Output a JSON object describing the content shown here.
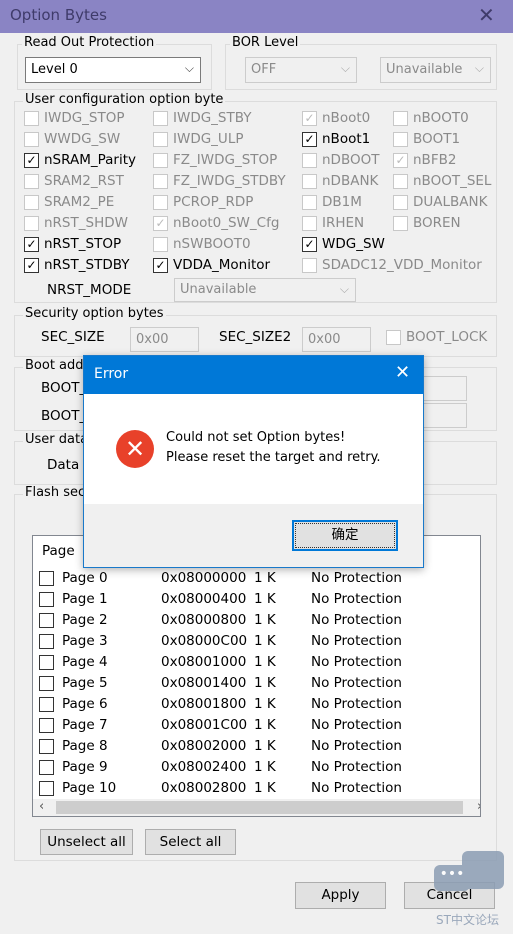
{
  "window": {
    "title": "Option Bytes",
    "close_icon": "close-icon"
  },
  "rop": {
    "label": "Read Out Protection",
    "value": "Level 0"
  },
  "bor": {
    "label": "BOR Level",
    "value": "OFF",
    "value2": "Unavailable"
  },
  "user_config": {
    "label": "User configuration option byte",
    "items": [
      [
        {
          "label": "IWDG_STOP",
          "checked": false,
          "enabled": false
        },
        {
          "label": "IWDG_STBY",
          "checked": false,
          "enabled": false
        },
        {
          "label": "nBoot0",
          "checked": true,
          "enabled": false
        },
        {
          "label": "nBOOT0",
          "checked": false,
          "enabled": false
        }
      ],
      [
        {
          "label": "WWDG_SW",
          "checked": false,
          "enabled": false
        },
        {
          "label": "IWDG_ULP",
          "checked": false,
          "enabled": false
        },
        {
          "label": "nBoot1",
          "checked": true,
          "enabled": true
        },
        {
          "label": "BOOT1",
          "checked": false,
          "enabled": false
        }
      ],
      [
        {
          "label": "nSRAM_Parity",
          "checked": true,
          "enabled": true
        },
        {
          "label": "FZ_IWDG_STOP",
          "checked": false,
          "enabled": false
        },
        {
          "label": "nDBOOT",
          "checked": false,
          "enabled": false
        },
        {
          "label": "nBFB2",
          "checked": true,
          "enabled": false
        }
      ],
      [
        {
          "label": "SRAM2_RST",
          "checked": false,
          "enabled": false
        },
        {
          "label": "FZ_IWDG_STDBY",
          "checked": false,
          "enabled": false
        },
        {
          "label": "nDBANK",
          "checked": false,
          "enabled": false
        },
        {
          "label": "nBOOT_SEL",
          "checked": false,
          "enabled": false
        }
      ],
      [
        {
          "label": "SRAM2_PE",
          "checked": false,
          "enabled": false
        },
        {
          "label": "PCROP_RDP",
          "checked": false,
          "enabled": false
        },
        {
          "label": "DB1M",
          "checked": false,
          "enabled": false
        },
        {
          "label": "DUALBANK",
          "checked": false,
          "enabled": false
        }
      ],
      [
        {
          "label": "nRST_SHDW",
          "checked": false,
          "enabled": false
        },
        {
          "label": "nBoot0_SW_Cfg",
          "checked": true,
          "enabled": false
        },
        {
          "label": "IRHEN",
          "checked": false,
          "enabled": false
        },
        {
          "label": "BOREN",
          "checked": false,
          "enabled": false
        }
      ],
      [
        {
          "label": "nRST_STOP",
          "checked": true,
          "enabled": true
        },
        {
          "label": "nSWBOOT0",
          "checked": false,
          "enabled": false
        },
        {
          "label": "WDG_SW",
          "checked": true,
          "enabled": true
        }
      ],
      [
        {
          "label": "nRST_STDBY",
          "checked": true,
          "enabled": true
        },
        {
          "label": "VDDA_Monitor",
          "checked": true,
          "enabled": true
        },
        {
          "label": "SDADC12_VDD_Monitor",
          "checked": false,
          "enabled": false
        }
      ]
    ],
    "nrst_mode_label": "NRST_MODE",
    "nrst_mode_value": "Unavailable"
  },
  "security": {
    "label": "Security option bytes",
    "sec_size_label": "SEC_SIZE",
    "sec_size": "0x00",
    "sec_size2_label": "SEC_SIZE2",
    "sec_size2": "0x00",
    "boot_lock": "BOOT_LOCK"
  },
  "boot_addr": {
    "label": "Boot addr",
    "boot0": "BOOT_",
    "boot1": "BOOT_"
  },
  "user_data": {
    "label": "User data",
    "data0": "Data 0"
  },
  "flash": {
    "label": "Flash sect",
    "header": "Page",
    "rows": [
      [
        "Page 0",
        "0x08000000",
        "1 K",
        "No Protection"
      ],
      [
        "Page 1",
        "0x08000400",
        "1 K",
        "No Protection"
      ],
      [
        "Page 2",
        "0x08000800",
        "1 K",
        "No Protection"
      ],
      [
        "Page 3",
        "0x08000C00",
        "1 K",
        "No Protection"
      ],
      [
        "Page 4",
        "0x08001000",
        "1 K",
        "No Protection"
      ],
      [
        "Page 5",
        "0x08001400",
        "1 K",
        "No Protection"
      ],
      [
        "Page 6",
        "0x08001800",
        "1 K",
        "No Protection"
      ],
      [
        "Page 7",
        "0x08001C00",
        "1 K",
        "No Protection"
      ],
      [
        "Page 8",
        "0x08002000",
        "1 K",
        "No Protection"
      ],
      [
        "Page 9",
        "0x08002400",
        "1 K",
        "No Protection"
      ],
      [
        "Page 10",
        "0x08002800",
        "1 K",
        "No Protection"
      ]
    ],
    "unselect_all": "Unselect all",
    "select_all": "Select all"
  },
  "footer": {
    "apply": "Apply",
    "cancel": "Cancel",
    "watermark": "ST中文论坛"
  },
  "error_dialog": {
    "title": "Error",
    "line1": "Could not set Option bytes!",
    "line2": "Please reset the target and retry.",
    "ok": "确定",
    "icon": "error-icon"
  }
}
